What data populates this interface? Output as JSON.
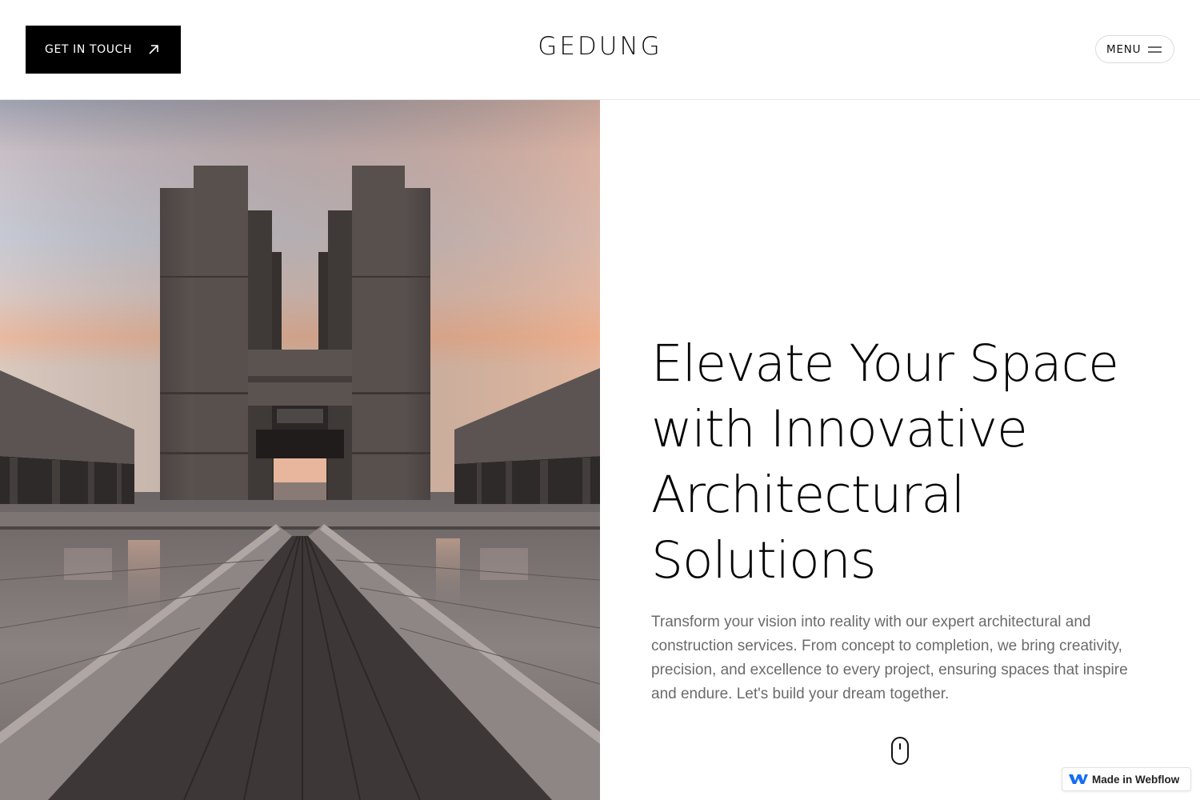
{
  "header": {
    "cta_label": "GET IN TOUCH",
    "cta_icon": "arrow-up-right-icon",
    "brand": "GEDUNG",
    "menu_label": "MENU",
    "menu_icon": "hamburger-icon"
  },
  "hero": {
    "image_alt": "Brutalist concrete building at sunset",
    "title_lines": [
      "Elevate Your Space",
      "with Innovative",
      "Architectural",
      "Solutions"
    ],
    "description_lines": [
      "Transform your vision into reality with our expert architectural and",
      "construction services. From concept to completion, we bring creativity,",
      "precision, and excellence to every project, ensuring spaces that inspire",
      "and endure. Let's build your dream together."
    ],
    "scroll_icon": "mouse-scroll-icon"
  },
  "badge": {
    "label": "Made in Webflow",
    "icon": "webflow-logo-icon"
  },
  "colors": {
    "cta_background": "#000000",
    "text_primary": "#050505",
    "text_secondary": "#6b6b6b",
    "webflow_blue": "#146ef5"
  }
}
